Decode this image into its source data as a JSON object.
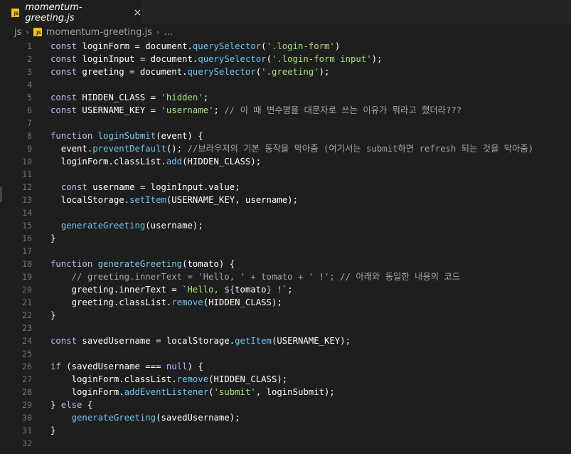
{
  "tab": {
    "badge": "JS",
    "title": "momentum-greeting.js",
    "close": "×"
  },
  "breadcrumb": {
    "folder": "js",
    "sep": "›",
    "badge": "JS",
    "file": "momentum-greeting.js",
    "sep2": "›",
    "more": "..."
  },
  "colors": {
    "background": "#1e1e1e",
    "keyword": "#cbb2f0",
    "method": "#6bc6f0",
    "string": "#a4e27a",
    "comment": "#a6a6a6",
    "js_badge": "#f1c40f"
  },
  "lines": [
    {
      "n": "1",
      "tokens": [
        [
          "kw",
          "const"
        ],
        [
          "id",
          " loginForm = document."
        ],
        [
          "fn",
          "querySelector"
        ],
        [
          "id",
          "("
        ],
        [
          "str",
          "'.login-form'"
        ],
        [
          "id",
          ")"
        ]
      ]
    },
    {
      "n": "2",
      "tokens": [
        [
          "kw",
          "const"
        ],
        [
          "id",
          " loginInput = document."
        ],
        [
          "fn",
          "querySelector"
        ],
        [
          "id",
          "("
        ],
        [
          "str",
          "'.login-form input'"
        ],
        [
          "id",
          ");"
        ]
      ]
    },
    {
      "n": "3",
      "tokens": [
        [
          "kw",
          "const"
        ],
        [
          "id",
          " greeting = document."
        ],
        [
          "fn",
          "querySelector"
        ],
        [
          "id",
          "("
        ],
        [
          "str",
          "'.greeting'"
        ],
        [
          "id",
          ");"
        ]
      ]
    },
    {
      "n": "4",
      "tokens": []
    },
    {
      "n": "5",
      "tokens": [
        [
          "kw",
          "const"
        ],
        [
          "id",
          " HIDDEN_CLASS = "
        ],
        [
          "str",
          "'hidden'"
        ],
        [
          "id",
          ";"
        ]
      ]
    },
    {
      "n": "6",
      "tokens": [
        [
          "kw",
          "const"
        ],
        [
          "id",
          " USERNAME_KEY = "
        ],
        [
          "str",
          "'username'"
        ],
        [
          "id",
          "; "
        ],
        [
          "cm",
          "// 이 때 변수명을 대문자로 쓰는 이유가 뭐라고 했더라???"
        ]
      ]
    },
    {
      "n": "7",
      "tokens": []
    },
    {
      "n": "8",
      "tokens": [
        [
          "kw",
          "function"
        ],
        [
          "id",
          " "
        ],
        [
          "fnd",
          "loginSubmit"
        ],
        [
          "id",
          "(event) {"
        ]
      ]
    },
    {
      "n": "9",
      "tokens": [
        [
          "id",
          "  event."
        ],
        [
          "fn",
          "preventDefault"
        ],
        [
          "id",
          "(); "
        ],
        [
          "cm",
          "//브라우저의 기본 동작을 막아줌 (여기서는 submit하면 refresh 되는 것을 막아줌)"
        ]
      ]
    },
    {
      "n": "10",
      "tokens": [
        [
          "id",
          "  loginForm.classList."
        ],
        [
          "fn",
          "add"
        ],
        [
          "id",
          "(HIDDEN_CLASS);"
        ]
      ]
    },
    {
      "n": "11",
      "tokens": []
    },
    {
      "n": "12",
      "tokens": [
        [
          "id",
          "  "
        ],
        [
          "kw",
          "const"
        ],
        [
          "id",
          " username = loginInput.value;"
        ]
      ]
    },
    {
      "n": "13",
      "tokens": [
        [
          "id",
          "  localStorage."
        ],
        [
          "fn",
          "setItem"
        ],
        [
          "id",
          "(USERNAME_KEY, username);"
        ]
      ]
    },
    {
      "n": "14",
      "tokens": []
    },
    {
      "n": "15",
      "tokens": [
        [
          "id",
          "  "
        ],
        [
          "fn",
          "generateGreeting"
        ],
        [
          "id",
          "(username);"
        ]
      ]
    },
    {
      "n": "16",
      "tokens": [
        [
          "id",
          "}"
        ]
      ]
    },
    {
      "n": "17",
      "tokens": []
    },
    {
      "n": "18",
      "tokens": [
        [
          "kw",
          "function"
        ],
        [
          "id",
          " "
        ],
        [
          "fnd",
          "generateGreeting"
        ],
        [
          "id",
          "(tomato) {"
        ]
      ]
    },
    {
      "n": "19",
      "tokens": [
        [
          "cm",
          "    // greeting.innerText = 'Hello, ' + tomato + ' !'; // 아래와 동일한 내용의 코드"
        ]
      ]
    },
    {
      "n": "20",
      "tokens": [
        [
          "id",
          "    greeting.innerText = "
        ],
        [
          "str",
          "`Hello, "
        ],
        [
          "kw",
          "${"
        ],
        [
          "id",
          "tomato"
        ],
        [
          "kw",
          "}"
        ],
        [
          "str",
          " !`"
        ],
        [
          "id",
          ";"
        ]
      ]
    },
    {
      "n": "21",
      "tokens": [
        [
          "id",
          "    greeting.classList."
        ],
        [
          "fn",
          "remove"
        ],
        [
          "id",
          "(HIDDEN_CLASS);"
        ]
      ]
    },
    {
      "n": "22",
      "tokens": [
        [
          "id",
          "}"
        ]
      ]
    },
    {
      "n": "23",
      "tokens": []
    },
    {
      "n": "24",
      "tokens": [
        [
          "kw",
          "const"
        ],
        [
          "id",
          " savedUsername = localStorage."
        ],
        [
          "fn",
          "getItem"
        ],
        [
          "id",
          "(USERNAME_KEY);"
        ]
      ]
    },
    {
      "n": "25",
      "tokens": []
    },
    {
      "n": "26",
      "tokens": [
        [
          "kw",
          "if"
        ],
        [
          "id",
          " (savedUsername === "
        ],
        [
          "nul",
          "null"
        ],
        [
          "id",
          ") {"
        ]
      ]
    },
    {
      "n": "27",
      "tokens": [
        [
          "id",
          "    loginForm.classList."
        ],
        [
          "fn",
          "remove"
        ],
        [
          "id",
          "(HIDDEN_CLASS);"
        ]
      ]
    },
    {
      "n": "28",
      "tokens": [
        [
          "id",
          "    loginForm."
        ],
        [
          "fn",
          "addEventListener"
        ],
        [
          "id",
          "("
        ],
        [
          "str",
          "'submit'"
        ],
        [
          "id",
          ", loginSubmit);"
        ]
      ]
    },
    {
      "n": "29",
      "tokens": [
        [
          "id",
          "} "
        ],
        [
          "kw",
          "else"
        ],
        [
          "id",
          " {"
        ]
      ]
    },
    {
      "n": "30",
      "tokens": [
        [
          "id",
          "    "
        ],
        [
          "fn",
          "generateGreeting"
        ],
        [
          "id",
          "(savedUsername);"
        ]
      ]
    },
    {
      "n": "31",
      "tokens": [
        [
          "id",
          "}"
        ]
      ]
    },
    {
      "n": "32",
      "tokens": []
    }
  ]
}
